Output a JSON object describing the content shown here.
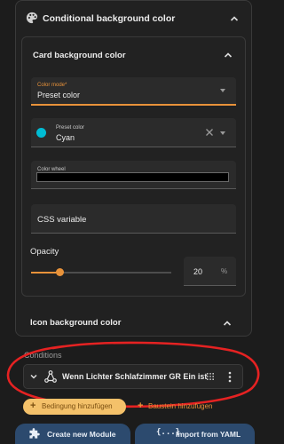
{
  "outer_panel": {
    "title": "Conditional background color",
    "icon": "palette-icon",
    "expanded": true
  },
  "card_background": {
    "title": "Card background color",
    "expanded": true,
    "color_mode": {
      "label": "Color mode*",
      "value": "Preset color"
    },
    "preset_color": {
      "label": "Preset color",
      "value": "Cyan",
      "swatch": "#00bcd4"
    },
    "color_wheel": {
      "label": "Color wheel",
      "value": "#000000"
    },
    "css_variable": {
      "label": "CSS variable"
    },
    "opacity": {
      "label": "Opacity",
      "value": "20",
      "unit": "%",
      "level": 0.2
    }
  },
  "icon_background": {
    "title": "Icon background color",
    "expanded": false
  },
  "conditions": {
    "label": "Conditions",
    "items": [
      {
        "text": "Wenn Lichter Schlafzimmer GR Ein ist",
        "icon": "condition-tree-icon"
      }
    ]
  },
  "actions": {
    "add_condition": "Bedingung hinzufügen",
    "add_block": "Baustein hinzufügen"
  },
  "bottom_buttons": {
    "create_module": "Create new Module",
    "import_yaml": "Import from YAML",
    "import_glyph": "{...}"
  },
  "colors": {
    "background": "#1c1c1c",
    "accent": "#e8923a",
    "add_condition_bg": "#f4c16a",
    "bottom_button_bg": "#2c4a6e",
    "annotation": "#e52222"
  }
}
